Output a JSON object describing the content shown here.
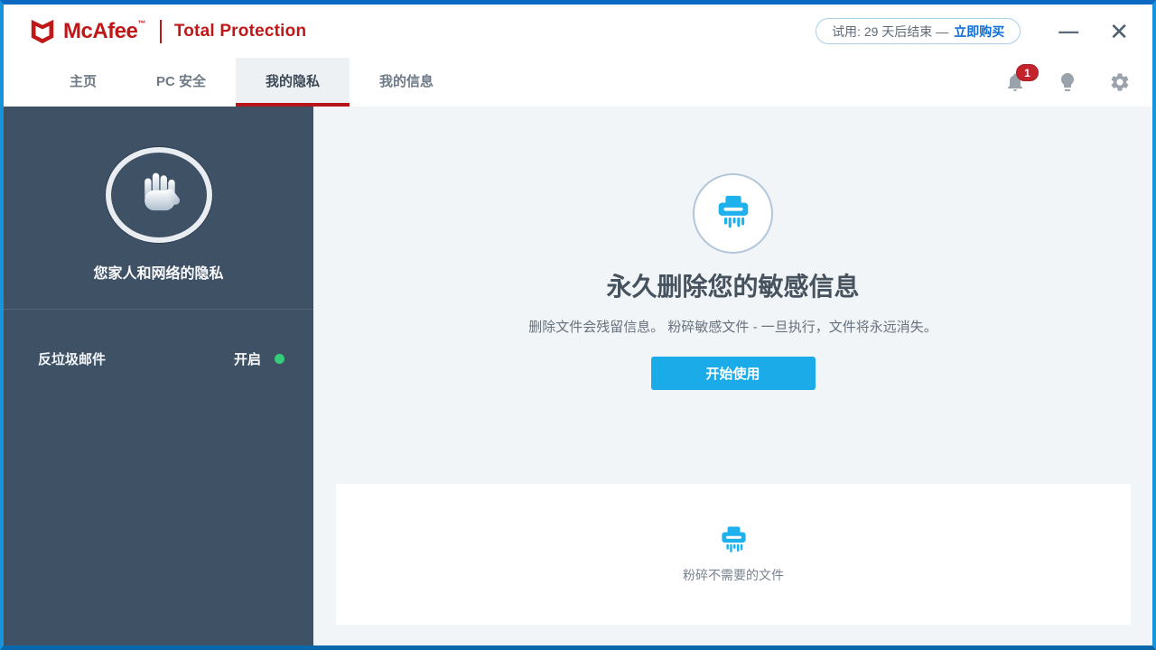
{
  "window": {
    "minimize_glyph": "—",
    "close_glyph": "✕"
  },
  "header": {
    "brand": "McAfee",
    "trademark": "™",
    "product": "Total Protection",
    "trial_text": "试用: 29 天后结束 —",
    "buy_now": "立即购买"
  },
  "nav": {
    "tabs": [
      {
        "label": "主页"
      },
      {
        "label": "PC 安全"
      },
      {
        "label": "我的隐私"
      },
      {
        "label": "我的信息"
      }
    ],
    "notification_count": "1"
  },
  "sidebar": {
    "title": "您家人和网络的隐私",
    "items": [
      {
        "label": "反垃圾邮件",
        "status": "开启"
      }
    ]
  },
  "main": {
    "heading": "永久删除您的敏感信息",
    "description": "删除文件会残留信息。 粉碎敏感文件 - 一旦执行，文件将永远消失。",
    "cta": "开始使用",
    "card": {
      "label": "粉碎不需要的文件"
    }
  },
  "colors": {
    "brand_red": "#c01818",
    "accent_blue": "#1aabe8",
    "link_blue": "#0d6ed8",
    "sidebar_bg": "#3f5165",
    "status_green": "#35cd7a",
    "tab_underline_red": "#b6151a",
    "badge_red": "#c3242b"
  }
}
